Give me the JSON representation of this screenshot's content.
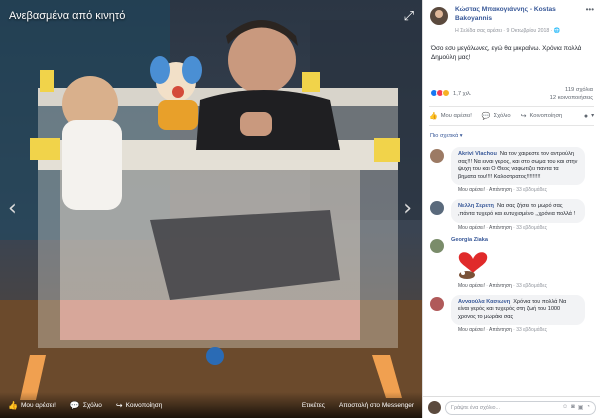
{
  "theater": {
    "album_link": "Ανεβασμένα από κινητό",
    "bottom_actions": [
      {
        "icon": "like-icon",
        "label": "Μου αρέσει!"
      },
      {
        "icon": "comment-icon",
        "label": "Σχόλιο"
      },
      {
        "icon": "share-icon",
        "label": "Κοινοποίηση"
      }
    ],
    "right_actions": [
      "Ετικέτες",
      "Αποστολή στο Messenger"
    ]
  },
  "post": {
    "author": "Κώστας Μπακογιάννης - Kostas Bakoyannis",
    "meta": "Η Σελίδα σας αρέσει · 9 Οκτωβρίου 2018 ·",
    "text": "Όσο εσυ μεγάλωνες, εγώ θα μικραίνω. Χρόνια πολλά Δημούλη μας!",
    "reaction_count": "1,7 χιλ.",
    "comments_count": "119 σχόλια",
    "shares_count": "12 κοινοποιήσεις",
    "actions": {
      "like": "Μου αρέσει!",
      "comment": "Σχόλιο",
      "share": "Κοινοποίηση"
    },
    "sort_label": "Πιο σχετικά ▾"
  },
  "comments": [
    {
      "name": "Akrivi Vlachou",
      "text": "Να τον χαιρεστε τον αντρούλη σας!!! Να ειναι γερος, και στο σωμα του και στην ψυχη του και Ο Θεος ναφωτιζει παντα τα βηματα του!!!! Καλοστρατος!!!!!!!!!",
      "meta_like": "Μου αρέσει!",
      "meta_reply": "Απάντηση",
      "meta_time": "33 εβδομάδες"
    },
    {
      "name": "Νελλη Σερετη",
      "text": "Να σας ζήσει το μωρό σας ,πάντα τυχερό και ευτυχισμένο ,,χρόνια πολλά !",
      "meta_like": "Μου αρέσει!",
      "meta_reply": "Απάντηση",
      "meta_time": "33 εβδομάδες"
    },
    {
      "name": "Georgia Ziaka",
      "text": "",
      "meta_like": "Μου αρέσει!",
      "meta_reply": "Απάντηση",
      "meta_time": "33 εβδομάδες"
    },
    {
      "name": "Ανναούλα Κασιωνη",
      "text": "Χρόνια του πολλά Να είναι γερός και τυχερός στη ζωή του 1000 χρονος το μωράκι σας",
      "meta_like": "Μου αρέσει!",
      "meta_reply": "Απάντηση",
      "meta_time": "33 εβδομάδες"
    }
  ],
  "composer": {
    "placeholder": "Γράψτε ένα σχόλιο..."
  }
}
